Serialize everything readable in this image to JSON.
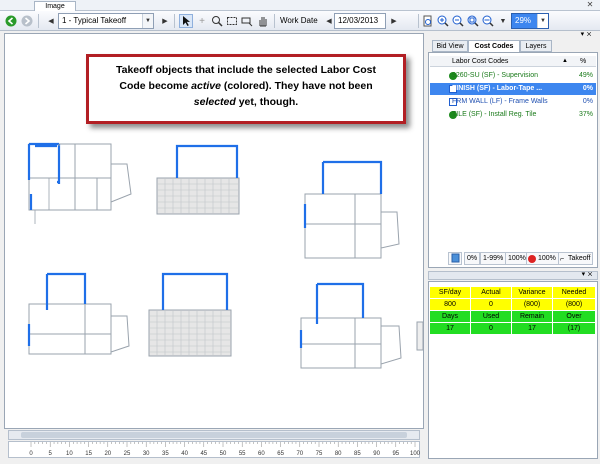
{
  "tabstrip": {
    "tab_label": "Image",
    "close_glyph": "✕"
  },
  "toolbar": {
    "page_select": "1 - Typical Takeoff",
    "work_date_label": "Work Date",
    "work_date_value": "12/03/2013",
    "zoom_value": "29%",
    "icons": [
      "back-icon",
      "forward-icon",
      "prev-page-icon",
      "next-page-icon",
      "pointer-icon",
      "crosshair-icon",
      "zoom-window-icon",
      "select-box-icon",
      "erase-icon",
      "pan-hand-icon",
      "zoom-icons"
    ]
  },
  "callout": {
    "line1": "Takeoff objects that include the selected Labor Cost",
    "line2_pre": "Code become ",
    "line2_em": "active",
    "line2_post": " (colored).  They have not been",
    "line3_em": "selected",
    "line3_post": " yet, though."
  },
  "right_panel": {
    "tabs": [
      "Bid View",
      "Cost Codes",
      "Layers"
    ],
    "active_tab": "Cost Codes",
    "header_col": "Labor Cost Codes",
    "header_pct": "%",
    "rows": [
      {
        "label": "9260-SU (SF) - Supervision",
        "pct": "49%",
        "icon": "green-dot"
      },
      {
        "label": "FINISH (SF) - Labor-Tape ...",
        "pct": "0%",
        "icon": "blue-box",
        "selected": true
      },
      {
        "label": "FRM WALL (LF) - Frame Walls",
        "pct": "0%",
        "icon": "blue-box"
      },
      {
        "label": "TILE (SF) - Install Reg. Tile",
        "pct": "37%",
        "icon": "green-dot"
      }
    ],
    "filter_buttons": [
      "0%",
      "1-99%",
      "100%",
      "100%",
      "Takeoff"
    ]
  },
  "stats": {
    "headers": [
      "SF/day",
      "Actual",
      "Variance",
      "Needed"
    ],
    "values": [
      "800",
      "0",
      "(800)",
      "(800)"
    ],
    "headers2": [
      "Days",
      "Used",
      "Remain",
      "Over"
    ],
    "values2": [
      "17",
      "0",
      "17",
      "(17)"
    ]
  },
  "ruler": {
    "ticks": [
      "0",
      "5",
      "10",
      "15",
      "20",
      "25",
      "30",
      "35",
      "40",
      "45",
      "50",
      "55",
      "60",
      "65",
      "70",
      "75",
      "80",
      "85",
      "90",
      "95",
      "100"
    ]
  },
  "colors": {
    "accent": "#3d86ef",
    "callout_border": "#b21f24",
    "active_blue": "#1f6fe8",
    "green": "#22dd22",
    "yellow": "#ffff00"
  }
}
